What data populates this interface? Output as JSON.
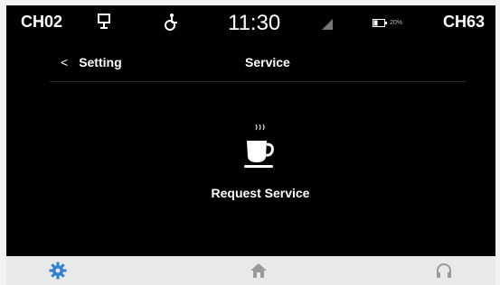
{
  "status_bar": {
    "channel_left": "CH02",
    "channel_right": "CH63",
    "time": "11:30",
    "battery_text": "20%"
  },
  "nav": {
    "back_label": "Setting",
    "title": "Service"
  },
  "service": {
    "label": "Request Service"
  },
  "bottom_nav": {
    "active_color": "#2f7fd8",
    "inactive_color": "#9a9a9a"
  },
  "icons": [
    "monitor-icon",
    "accessibility-icon",
    "signal-icon",
    "battery-icon",
    "back-arrow-icon",
    "coffee-cup-icon",
    "gear-icon",
    "home-icon",
    "headphones-icon"
  ]
}
